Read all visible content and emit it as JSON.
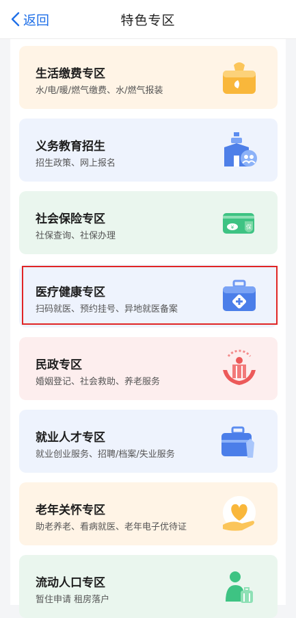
{
  "header": {
    "back_label": "返回",
    "title": "特色专区"
  },
  "cards": [
    {
      "name": "生活缴费专区",
      "desc": "水/电/暖/燃气缴费、水/燃气报装"
    },
    {
      "name": "义务教育招生",
      "desc": "招生政策、网上报名"
    },
    {
      "name": "社会保险专区",
      "desc": "社保查询、社保办理"
    },
    {
      "name": "医疗健康专区",
      "desc": "扫码就医、预约挂号、异地就医备案"
    },
    {
      "name": "民政专区",
      "desc": "婚姻登记、社会救助、养老服务"
    },
    {
      "name": "就业人才专区",
      "desc": "就业创业服务、招聘/档案/失业服务"
    },
    {
      "name": "老年关怀专区",
      "desc": "助老养老、看病就医、老年电子优待证"
    },
    {
      "name": "流动人口专区",
      "desc": "暂住申请 租房落户"
    }
  ],
  "icons": [
    "money-bag-icon",
    "school-icon",
    "social-insurance-card-icon",
    "medical-kit-icon",
    "civil-affairs-icon",
    "briefcase-icon",
    "heart-hand-icon",
    "migrant-person-icon"
  ],
  "colors": {
    "accent": "#1e6fe8",
    "highlight": "#e02424"
  }
}
